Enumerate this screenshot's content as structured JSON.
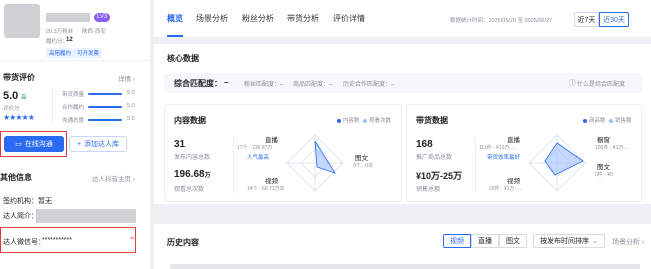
{
  "profile": {
    "fans_text": "20.3万粉丝",
    "location_text": "陕西·西安",
    "level": "LV3",
    "fulfillment_label": "履约分：",
    "fulfillment_value": "12",
    "tags": [
      "高陪履约",
      "可开发票"
    ]
  },
  "rating": {
    "title": "带货评价",
    "details_link": "详情 ›",
    "score": "5.0",
    "score_badge": "高",
    "score_label": "评价分",
    "stars": "★★★★★",
    "metrics": [
      {
        "label": "带货质量",
        "value": "5.0"
      },
      {
        "label": "合作履约",
        "value": "5.0"
      },
      {
        "label": "沟通态度",
        "value": "5.0"
      }
    ]
  },
  "actions": {
    "chat_button": "在线沟通",
    "add_button": "添加达人库"
  },
  "other_info": {
    "title": "其他信息",
    "homepage_link": "达人抖音主页 ›",
    "agency": "签约机构：暂无",
    "intro_label": "达人简介：",
    "wechat_label": "达人微信号：",
    "wechat_value": "***********",
    "wechat_arrow": "⌄"
  },
  "tabs": [
    "概览",
    "场景分析",
    "粉丝分析",
    "带货分析",
    "评价详情"
  ],
  "date_range": {
    "label": "数据统计时间：2025/05/28 至 2025/06/27",
    "btn7": "近7天",
    "btn30": "近30天"
  },
  "core": {
    "title": "核心数据",
    "match_label": "综合匹配度：",
    "match_value": "–",
    "fans_match": "粉丝匹配度：–",
    "product_match": "商品匹配度：–",
    "history_match": "历史合作匹配度：–",
    "help_text": "什么是综合匹配度"
  },
  "content_panel": {
    "title": "内容数据",
    "legend_content": "内容数",
    "legend_views": "观看次数",
    "count": "31",
    "count_label": "发布内容总数",
    "views": "196.68",
    "views_unit": "万",
    "views_label": "观看总次数",
    "radar_live": "直播",
    "radar_live_sub": "17个 · 136.97万",
    "radar_live_tag": "人气最高",
    "radar_text": "图文",
    "radar_text_sub": "0个 · 0次",
    "radar_video": "视频",
    "radar_video_sub": "14个 · 60.71万次"
  },
  "goods_panel": {
    "title": "带货数据",
    "legend_goods": "商品数",
    "legend_sales": "销售额",
    "count": "168",
    "count_label": "推广商品总数",
    "sales": "¥10万-25万",
    "sales_label": "销售总额",
    "radar_live": "直播",
    "radar_live_sub": "111件 · ¥10万-…",
    "radar_live_tag": "带货效率最好",
    "radar_window": "橱窗",
    "radar_window_sub": "106件 · ¥1万-…",
    "radar_text": "图文",
    "radar_text_sub": "0件 · ¥0",
    "radar_video": "视频",
    "radar_video_sub": "20件 · ¥1万-…"
  },
  "history": {
    "title": "历史内容",
    "filters": [
      "视频",
      "直播",
      "图文"
    ],
    "sort": "按发布时间排序",
    "sort_arrow": "⌄",
    "analysis_link": "场景分析 ›"
  },
  "colors": {
    "accent": "#2a6bf2",
    "highlight_box": "#e53935",
    "level_badge": "#8a5cf6"
  }
}
